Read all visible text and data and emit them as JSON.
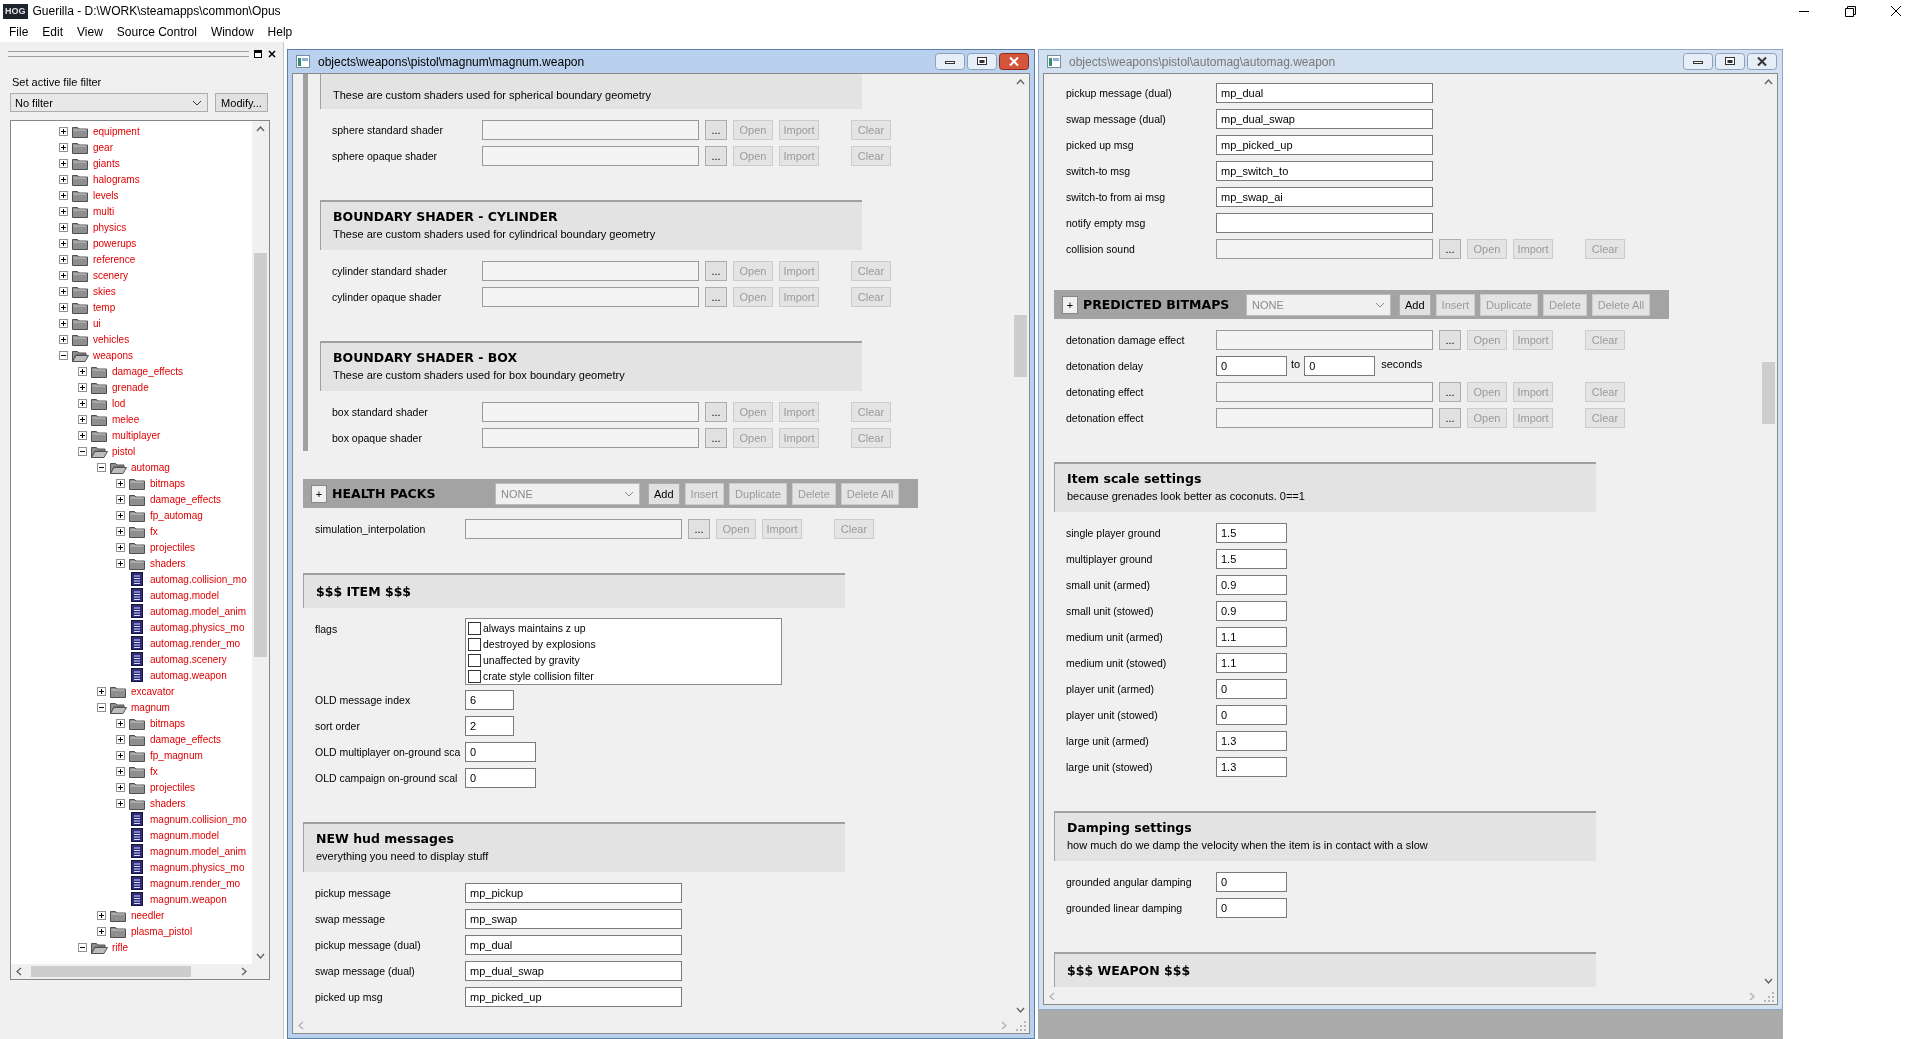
{
  "app": {
    "logo": "HOG",
    "title": "Guerilla - D:\\WORK\\steamapps\\common\\Opus"
  },
  "menu": [
    "File",
    "Edit",
    "View",
    "Source Control",
    "Window",
    "Help"
  ],
  "file_panel": {
    "filter_label": "Set active file filter",
    "filter_value": "No filter",
    "modify_button": "Modify...",
    "tree": [
      {
        "label": "equipment",
        "kind": "folder",
        "expanded": false
      },
      {
        "label": "gear",
        "kind": "folder",
        "expanded": false
      },
      {
        "label": "giants",
        "kind": "folder",
        "expanded": false
      },
      {
        "label": "halograms",
        "kind": "folder",
        "expanded": false
      },
      {
        "label": "levels",
        "kind": "folder",
        "expanded": false
      },
      {
        "label": "multi",
        "kind": "folder",
        "expanded": false
      },
      {
        "label": "physics",
        "kind": "folder",
        "expanded": false
      },
      {
        "label": "powerups",
        "kind": "folder",
        "expanded": false
      },
      {
        "label": "reference",
        "kind": "folder",
        "expanded": false
      },
      {
        "label": "scenery",
        "kind": "folder",
        "expanded": false
      },
      {
        "label": "skies",
        "kind": "folder",
        "expanded": false
      },
      {
        "label": "temp",
        "kind": "folder",
        "expanded": false
      },
      {
        "label": "ui",
        "kind": "folder",
        "expanded": false
      },
      {
        "label": "vehicles",
        "kind": "folder",
        "expanded": false
      },
      {
        "label": "weapons",
        "kind": "folder",
        "expanded": true,
        "children": [
          {
            "label": "damage_effects",
            "kind": "folder",
            "expanded": false
          },
          {
            "label": "grenade",
            "kind": "folder",
            "expanded": false
          },
          {
            "label": "lod",
            "kind": "folder",
            "expanded": false
          },
          {
            "label": "melee",
            "kind": "folder",
            "expanded": false
          },
          {
            "label": "multiplayer",
            "kind": "folder",
            "expanded": false
          },
          {
            "label": "pistol",
            "kind": "folder",
            "expanded": true,
            "children": [
              {
                "label": "automag",
                "kind": "folder",
                "expanded": true,
                "children": [
                  {
                    "label": "bitmaps",
                    "kind": "folder",
                    "expanded": false
                  },
                  {
                    "label": "damage_effects",
                    "kind": "folder",
                    "expanded": false
                  },
                  {
                    "label": "fp_automag",
                    "kind": "folder",
                    "expanded": false
                  },
                  {
                    "label": "fx",
                    "kind": "folder",
                    "expanded": false
                  },
                  {
                    "label": "projectiles",
                    "kind": "folder",
                    "expanded": false
                  },
                  {
                    "label": "shaders",
                    "kind": "folder",
                    "expanded": false
                  },
                  {
                    "label": "automag.collision_mo",
                    "kind": "file"
                  },
                  {
                    "label": "automag.model",
                    "kind": "file"
                  },
                  {
                    "label": "automag.model_anim",
                    "kind": "file"
                  },
                  {
                    "label": "automag.physics_mo",
                    "kind": "file"
                  },
                  {
                    "label": "automag.render_mo",
                    "kind": "file"
                  },
                  {
                    "label": "automag.scenery",
                    "kind": "file"
                  },
                  {
                    "label": "automag.weapon",
                    "kind": "file"
                  }
                ]
              },
              {
                "label": "excavator",
                "kind": "folder",
                "expanded": false
              },
              {
                "label": "magnum",
                "kind": "folder",
                "expanded": true,
                "children": [
                  {
                    "label": "bitmaps",
                    "kind": "folder",
                    "expanded": false
                  },
                  {
                    "label": "damage_effects",
                    "kind": "folder",
                    "expanded": false
                  },
                  {
                    "label": "fp_magnum",
                    "kind": "folder",
                    "expanded": false
                  },
                  {
                    "label": "fx",
                    "kind": "folder",
                    "expanded": false
                  },
                  {
                    "label": "projectiles",
                    "kind": "folder",
                    "expanded": false
                  },
                  {
                    "label": "shaders",
                    "kind": "folder",
                    "expanded": false
                  },
                  {
                    "label": "magnum.collision_mo",
                    "kind": "file"
                  },
                  {
                    "label": "magnum.model",
                    "kind": "file"
                  },
                  {
                    "label": "magnum.model_anim",
                    "kind": "file"
                  },
                  {
                    "label": "magnum.physics_mo",
                    "kind": "file"
                  },
                  {
                    "label": "magnum.render_mo",
                    "kind": "file"
                  },
                  {
                    "label": "magnum.weapon",
                    "kind": "file"
                  }
                ]
              },
              {
                "label": "needler",
                "kind": "folder",
                "expanded": false
              },
              {
                "label": "plasma_pistol",
                "kind": "folder",
                "expanded": false
              }
            ]
          },
          {
            "label": "rifle",
            "kind": "folder",
            "expanded": true
          }
        ]
      }
    ]
  },
  "windows": [
    {
      "title": "objects\\weapons\\pistol\\magnum\\magnum.weapon",
      "active": true,
      "content": [
        {
          "kind": "group",
          "items": [
            {
              "kind": "section",
              "subtitle": "These are custom shaders used for spherical boundary geometry"
            },
            {
              "kind": "tag",
              "label": "sphere standard shader",
              "buttons": [
                {
                  "kind": "browse",
                  "label": "...",
                  "disabled": false
                },
                {
                  "kind": "open",
                  "label": "Open",
                  "disabled": true
                },
                {
                  "kind": "import",
                  "label": "Import",
                  "disabled": true
                },
                {
                  "kind": "clear",
                  "label": "Clear",
                  "disabled": true
                }
              ]
            },
            {
              "kind": "tag",
              "label": "sphere opaque shader",
              "buttons": [
                {
                  "kind": "browse",
                  "label": "...",
                  "disabled": false
                },
                {
                  "kind": "open",
                  "label": "Open",
                  "disabled": true
                },
                {
                  "kind": "import",
                  "label": "Import",
                  "disabled": true
                },
                {
                  "kind": "clear",
                  "label": "Clear",
                  "disabled": true
                }
              ]
            },
            {
              "kind": "section",
              "title": "BOUNDARY SHADER - CYLINDER",
              "subtitle": "These are custom shaders used for cylindrical boundary geometry"
            },
            {
              "kind": "tag",
              "label": "cylinder standard shader",
              "buttons": [
                {
                  "kind": "browse",
                  "label": "...",
                  "disabled": false
                },
                {
                  "kind": "open",
                  "label": "Open",
                  "disabled": true
                },
                {
                  "kind": "import",
                  "label": "Import",
                  "disabled": true
                },
                {
                  "kind": "clear",
                  "label": "Clear",
                  "disabled": true
                }
              ]
            },
            {
              "kind": "tag",
              "label": "cylinder opaque shader",
              "buttons": [
                {
                  "kind": "browse",
                  "label": "...",
                  "disabled": false
                },
                {
                  "kind": "open",
                  "label": "Open",
                  "disabled": true
                },
                {
                  "kind": "import",
                  "label": "Import",
                  "disabled": true
                },
                {
                  "kind": "clear",
                  "label": "Clear",
                  "disabled": true
                }
              ]
            },
            {
              "kind": "section",
              "title": "BOUNDARY SHADER - BOX",
              "subtitle": "These are custom shaders used for box boundary geometry"
            },
            {
              "kind": "tag",
              "label": "box standard shader",
              "buttons": [
                {
                  "kind": "browse",
                  "label": "...",
                  "disabled": false
                },
                {
                  "kind": "open",
                  "label": "Open",
                  "disabled": true
                },
                {
                  "kind": "import",
                  "label": "Import",
                  "disabled": true
                },
                {
                  "kind": "clear",
                  "label": "Clear",
                  "disabled": true
                }
              ]
            },
            {
              "kind": "tag",
              "label": "box opaque shader",
              "buttons": [
                {
                  "kind": "browse",
                  "label": "...",
                  "disabled": false
                },
                {
                  "kind": "open",
                  "label": "Open",
                  "disabled": true
                },
                {
                  "kind": "import",
                  "label": "Import",
                  "disabled": true
                },
                {
                  "kind": "clear",
                  "label": "Clear",
                  "disabled": true
                }
              ]
            }
          ]
        },
        {
          "kind": "block",
          "expander": "+",
          "title": "HEALTH PACKS",
          "dropdown": {
            "value": "NONE",
            "disabled": true
          },
          "buttons": [
            {
              "kind": "add",
              "label": "Add",
              "disabled": false
            },
            {
              "kind": "insert",
              "label": "Insert",
              "disabled": true
            },
            {
              "kind": "duplicate",
              "label": "Duplicate",
              "disabled": true
            },
            {
              "kind": "delete",
              "label": "Delete",
              "disabled": true
            },
            {
              "kind": "delete-all",
              "label": "Delete All",
              "disabled": true
            }
          ]
        },
        {
          "kind": "tag",
          "label": "simulation_interpolation",
          "buttons": [
            {
              "kind": "browse",
              "label": "...",
              "disabled": false
            },
            {
              "kind": "open",
              "label": "Open",
              "disabled": true
            },
            {
              "kind": "import",
              "label": "Import",
              "disabled": true
            },
            {
              "kind": "clear",
              "label": "Clear",
              "disabled": true
            }
          ]
        },
        {
          "kind": "section",
          "title": "$$$ ITEM $$$"
        },
        {
          "kind": "flags",
          "label": "flags",
          "options": [
            {
              "label": "always maintains z up",
              "checked": false
            },
            {
              "label": "destroyed by explosions",
              "checked": false
            },
            {
              "label": "unaffected by gravity",
              "checked": false
            },
            {
              "label": "crate style collision filter",
              "checked": false
            }
          ]
        },
        {
          "kind": "short_field",
          "label": "OLD message index",
          "value": "6"
        },
        {
          "kind": "short_field",
          "label": "sort order",
          "value": "2"
        },
        {
          "kind": "number_field",
          "label": "OLD multiplayer on-ground sca",
          "value": "0"
        },
        {
          "kind": "number_field",
          "label": "OLD campaign on-ground scal",
          "value": "0"
        },
        {
          "kind": "section",
          "title": "NEW hud messages",
          "subtitle": "everything you need to display stuff"
        },
        {
          "kind": "text_field",
          "label": "pickup message",
          "value": "mp_pickup"
        },
        {
          "kind": "text_field",
          "label": "swap message",
          "value": "mp_swap"
        },
        {
          "kind": "text_field",
          "label": "pickup message (dual)",
          "value": "mp_dual"
        },
        {
          "kind": "text_field",
          "label": "swap message (dual)",
          "value": "mp_dual_swap"
        },
        {
          "kind": "text_field",
          "label": "picked up msg",
          "value": "mp_picked_up"
        }
      ]
    },
    {
      "title": "objects\\weapons\\pistol\\automag\\automag.weapon",
      "active": false,
      "content": [
        {
          "kind": "text_field",
          "label": "pickup message (dual)",
          "value": "mp_dual"
        },
        {
          "kind": "text_field",
          "label": "swap message (dual)",
          "value": "mp_dual_swap"
        },
        {
          "kind": "text_field",
          "label": "picked up msg",
          "value": "mp_picked_up"
        },
        {
          "kind": "text_field",
          "label": "switch-to msg",
          "value": "mp_switch_to"
        },
        {
          "kind": "text_field",
          "label": "switch-to from ai msg",
          "value": "mp_swap_ai"
        },
        {
          "kind": "text_field",
          "label": "notify empty msg"
        },
        {
          "kind": "tag",
          "label": "collision sound",
          "buttons": [
            {
              "kind": "browse",
              "label": "...",
              "disabled": false
            },
            {
              "kind": "open",
              "label": "Open",
              "disabled": true
            },
            {
              "kind": "import",
              "label": "Import",
              "disabled": true
            },
            {
              "kind": "clear",
              "label": "Clear",
              "disabled": true
            }
          ]
        },
        {
          "kind": "block",
          "expander": "+",
          "title": "PREDICTED BITMAPS",
          "dropdown": {
            "value": "NONE",
            "disabled": true
          },
          "buttons": [
            {
              "kind": "add",
              "label": "Add",
              "disabled": false
            },
            {
              "kind": "insert",
              "label": "Insert",
              "disabled": true
            },
            {
              "kind": "duplicate",
              "label": "Duplicate",
              "disabled": true
            },
            {
              "kind": "delete",
              "label": "Delete",
              "disabled": true
            },
            {
              "kind": "delete-all",
              "label": "Delete All",
              "disabled": true
            }
          ]
        },
        {
          "kind": "tag",
          "label": "detonation damage effect",
          "buttons": [
            {
              "kind": "browse",
              "label": "...",
              "disabled": false
            },
            {
              "kind": "open",
              "label": "Open",
              "disabled": true
            },
            {
              "kind": "import",
              "label": "Import",
              "disabled": true
            },
            {
              "kind": "clear",
              "label": "Clear",
              "disabled": true
            }
          ]
        },
        {
          "kind": "range",
          "label": "detonation delay",
          "from": "0",
          "joiner": "to",
          "to": "0",
          "unit": "seconds"
        },
        {
          "kind": "tag",
          "label": "detonating effect",
          "buttons": [
            {
              "kind": "browse",
              "label": "...",
              "disabled": false
            },
            {
              "kind": "open",
              "label": "Open",
              "disabled": true
            },
            {
              "kind": "import",
              "label": "Import",
              "disabled": true
            },
            {
              "kind": "clear",
              "label": "Clear",
              "disabled": true
            }
          ]
        },
        {
          "kind": "tag",
          "label": "detonation effect",
          "buttons": [
            {
              "kind": "browse",
              "label": "...",
              "disabled": false
            },
            {
              "kind": "open",
              "label": "Open",
              "disabled": true
            },
            {
              "kind": "import",
              "label": "Import",
              "disabled": true
            },
            {
              "kind": "clear",
              "label": "Clear",
              "disabled": true
            }
          ]
        },
        {
          "kind": "section",
          "title": "Item scale settings",
          "subtitle": "because grenades look better as coconuts. 0==1"
        },
        {
          "kind": "number_field",
          "label": "single player ground",
          "value": "1.5"
        },
        {
          "kind": "number_field",
          "label": "multiplayer ground",
          "value": "1.5"
        },
        {
          "kind": "number_field",
          "label": "small unit (armed)",
          "value": "0.9"
        },
        {
          "kind": "number_field",
          "label": "small unit (stowed)",
          "value": "0.9"
        },
        {
          "kind": "number_field",
          "label": "medium unit (armed)",
          "value": "1.1"
        },
        {
          "kind": "number_field",
          "label": "medium unit (stowed)",
          "value": "1.1"
        },
        {
          "kind": "number_field",
          "label": "player unit (armed)",
          "value": "0"
        },
        {
          "kind": "number_field",
          "label": "player unit (stowed)",
          "value": "0"
        },
        {
          "kind": "number_field",
          "label": "large unit (armed)",
          "value": "1.3"
        },
        {
          "kind": "number_field",
          "label": "large unit (stowed)",
          "value": "1.3"
        },
        {
          "kind": "section",
          "title": "Damping settings",
          "subtitle": "how much do we damp the velocity when the item is in contact with a slow"
        },
        {
          "kind": "number_field",
          "label": "grounded angular damping",
          "value": "0"
        },
        {
          "kind": "number_field",
          "label": "grounded linear damping",
          "value": "0"
        },
        {
          "kind": "section",
          "title": "$$$ WEAPON $$$"
        }
      ]
    }
  ]
}
